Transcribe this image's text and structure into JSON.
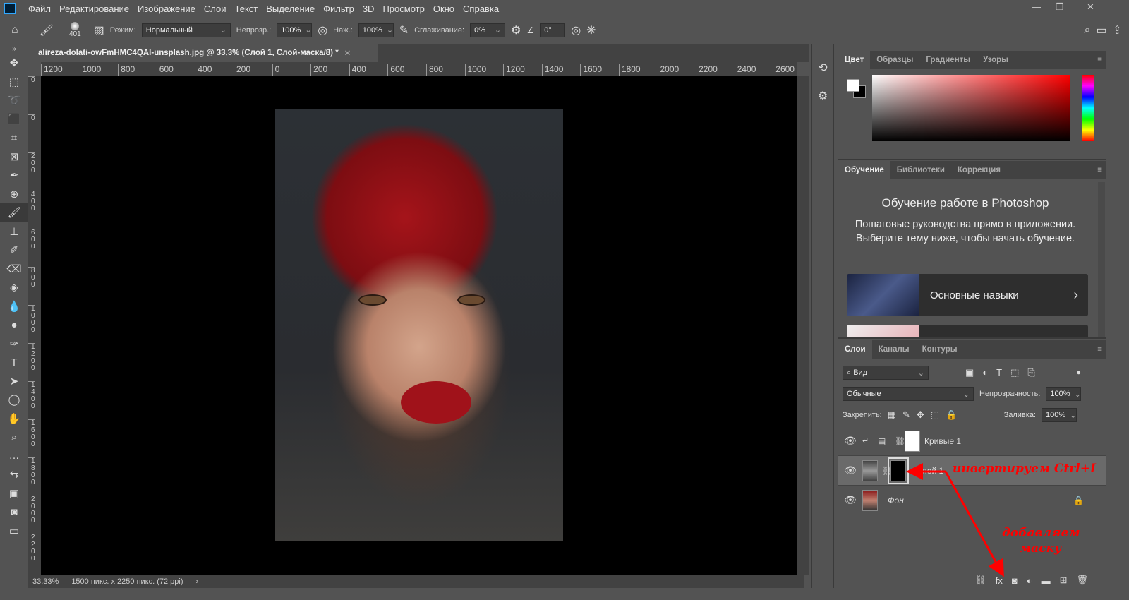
{
  "app": {
    "logo": "Ps"
  },
  "menu": [
    "Файл",
    "Редактирование",
    "Изображение",
    "Слои",
    "Текст",
    "Выделение",
    "Фильтр",
    "3D",
    "Просмотр",
    "Окно",
    "Справка"
  ],
  "options": {
    "brush_size": "401",
    "mode_label": "Режим:",
    "mode_value": "Нормальный",
    "opacity_label": "Непрозр.:",
    "opacity_value": "100%",
    "flow_label": "Наж.:",
    "flow_value": "100%",
    "smoothing_label": "Сглаживание:",
    "smoothing_value": "0%",
    "angle_value": "0°"
  },
  "document": {
    "tab_title": "alireza-dolati-owFmHMC4QAI-unsplash.jpg @ 33,3% (Слой 1, Слой-маска/8) *",
    "zoom": "33,33%",
    "dimensions": "1500 пикс. x 2250 пикс. (72 ppi)"
  },
  "ruler_h": [
    "1200",
    "1000",
    "800",
    "600",
    "400",
    "200",
    "0",
    "200",
    "400",
    "600",
    "800",
    "1000",
    "1200",
    "1400",
    "1600",
    "1800",
    "2000",
    "2200",
    "2400",
    "2600"
  ],
  "ruler_v": [
    "0",
    "0",
    "200",
    "400",
    "600",
    "800",
    "1000",
    "1200",
    "1400",
    "1600",
    "1800",
    "2000",
    "2200"
  ],
  "color_panel": {
    "tabs": [
      "Цвет",
      "Образцы",
      "Градиенты",
      "Узоры"
    ],
    "foreground": "#ffffff",
    "background": "#000000"
  },
  "learn_panel": {
    "tabs": [
      "Обучение",
      "Библиотеки",
      "Коррекция"
    ],
    "title": "Обучение работе в Photoshop",
    "description": "Пошаговые руководства прямо в приложении. Выберите тему ниже, чтобы начать обучение.",
    "course": "Основные навыки"
  },
  "layers_panel": {
    "tabs": [
      "Слои",
      "Каналы",
      "Контуры"
    ],
    "filter": "Вид",
    "blend_mode": "Обычные",
    "opacity_label": "Непрозрачность:",
    "opacity_value": "100%",
    "lock_label": "Закрепить:",
    "fill_label": "Заливка:",
    "fill_value": "100%",
    "layers": [
      {
        "name": "Кривые 1",
        "visible": true
      },
      {
        "name": "Слой 1",
        "visible": true,
        "selected": true
      },
      {
        "name": "Фон",
        "visible": true,
        "locked": true
      }
    ]
  },
  "annotations": {
    "invert": "инвертируем Ctrl+I",
    "add_mask_1": "добавляем",
    "add_mask_2": "маску",
    "color": "#ff0000"
  }
}
